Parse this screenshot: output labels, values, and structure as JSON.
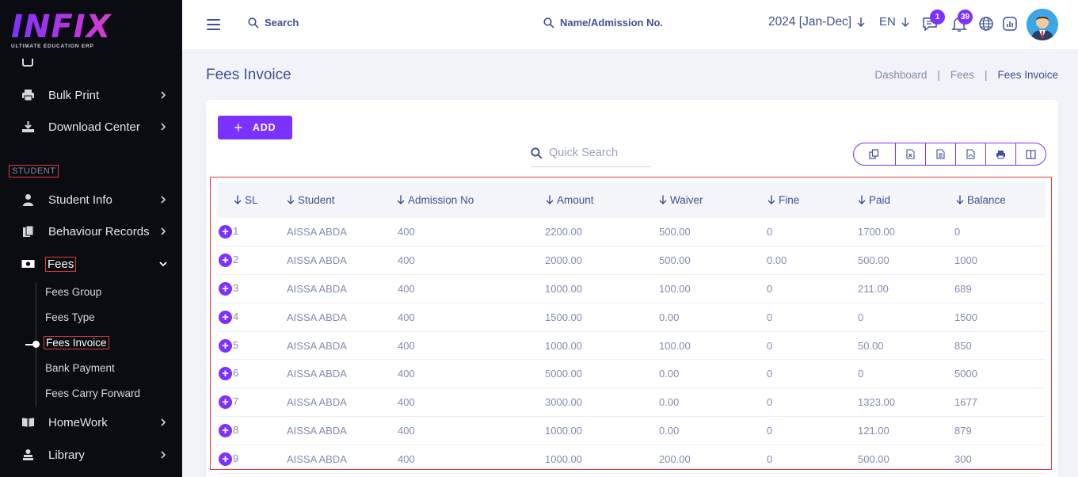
{
  "brand": {
    "logo_text": "INFIX",
    "tagline": "ULTIMATE EDUCATION ERP"
  },
  "sidebar": {
    "items_top": [
      {
        "label": "Bulk Print",
        "icon": "printer-icon"
      },
      {
        "label": "Download Center",
        "icon": "download-icon"
      }
    ],
    "section_label": "STUDENT",
    "items": [
      {
        "label": "Student Info",
        "icon": "user-icon"
      },
      {
        "label": "Behaviour Records",
        "icon": "documents-icon"
      },
      {
        "label": "Fees",
        "icon": "money-icon"
      },
      {
        "label": "HomeWork",
        "icon": "book-icon"
      },
      {
        "label": "Library",
        "icon": "library-icon"
      }
    ],
    "fees_submenu": [
      "Fees Group",
      "Fees Type",
      "Fees Invoice",
      "Bank Payment",
      "Fees Carry Forward"
    ]
  },
  "header": {
    "search_label": "Search",
    "search2_label": "Name/Admission No.",
    "year": "2024 [Jan-Dec]",
    "language": "EN",
    "chat_badge": "1",
    "notification_badge": "39"
  },
  "page": {
    "title": "Fees Invoice",
    "breadcrumbs": [
      "Dashboard",
      "Fees",
      "Fees Invoice"
    ]
  },
  "toolbar": {
    "add_label": "ADD",
    "quick_search_placeholder": "Quick Search",
    "export_icons": [
      "copy-icon",
      "excel-icon",
      "csv-icon",
      "pdf-icon",
      "print-icon",
      "columns-icon"
    ]
  },
  "table": {
    "columns": [
      "SL",
      "Student",
      "Admission No",
      "Amount",
      "Waiver",
      "Fine",
      "Paid",
      "Balance"
    ],
    "rows": [
      [
        "1",
        "AISSA ABDA",
        "400",
        "2200.00",
        "500.00",
        "0",
        "1700.00",
        "0"
      ],
      [
        "2",
        "AISSA ABDA",
        "400",
        "2000.00",
        "500.00",
        "0.00",
        "500.00",
        "1000"
      ],
      [
        "3",
        "AISSA ABDA",
        "400",
        "1000.00",
        "100.00",
        "0",
        "211.00",
        "689"
      ],
      [
        "4",
        "AISSA ABDA",
        "400",
        "1500.00",
        "0.00",
        "0",
        "0",
        "1500"
      ],
      [
        "5",
        "AISSA ABDA",
        "400",
        "1000.00",
        "100.00",
        "0",
        "50.00",
        "850"
      ],
      [
        "6",
        "AISSA ABDA",
        "400",
        "5000.00",
        "0.00",
        "0",
        "0",
        "5000"
      ],
      [
        "7",
        "AISSA ABDA",
        "400",
        "3000.00",
        "0.00",
        "0",
        "1323.00",
        "1677"
      ],
      [
        "8",
        "AISSA ABDA",
        "400",
        "1000.00",
        "0.00",
        "0",
        "121.00",
        "879"
      ],
      [
        "9",
        "AISSA ABDA",
        "400",
        "1000.00",
        "200.00",
        "0",
        "500.00",
        "300"
      ]
    ]
  },
  "colors": {
    "accent": "#7c32ff",
    "sidebar_bg": "#0b0b12",
    "text": "#415094",
    "muted": "#828bb2",
    "highlight": "#e53935"
  }
}
